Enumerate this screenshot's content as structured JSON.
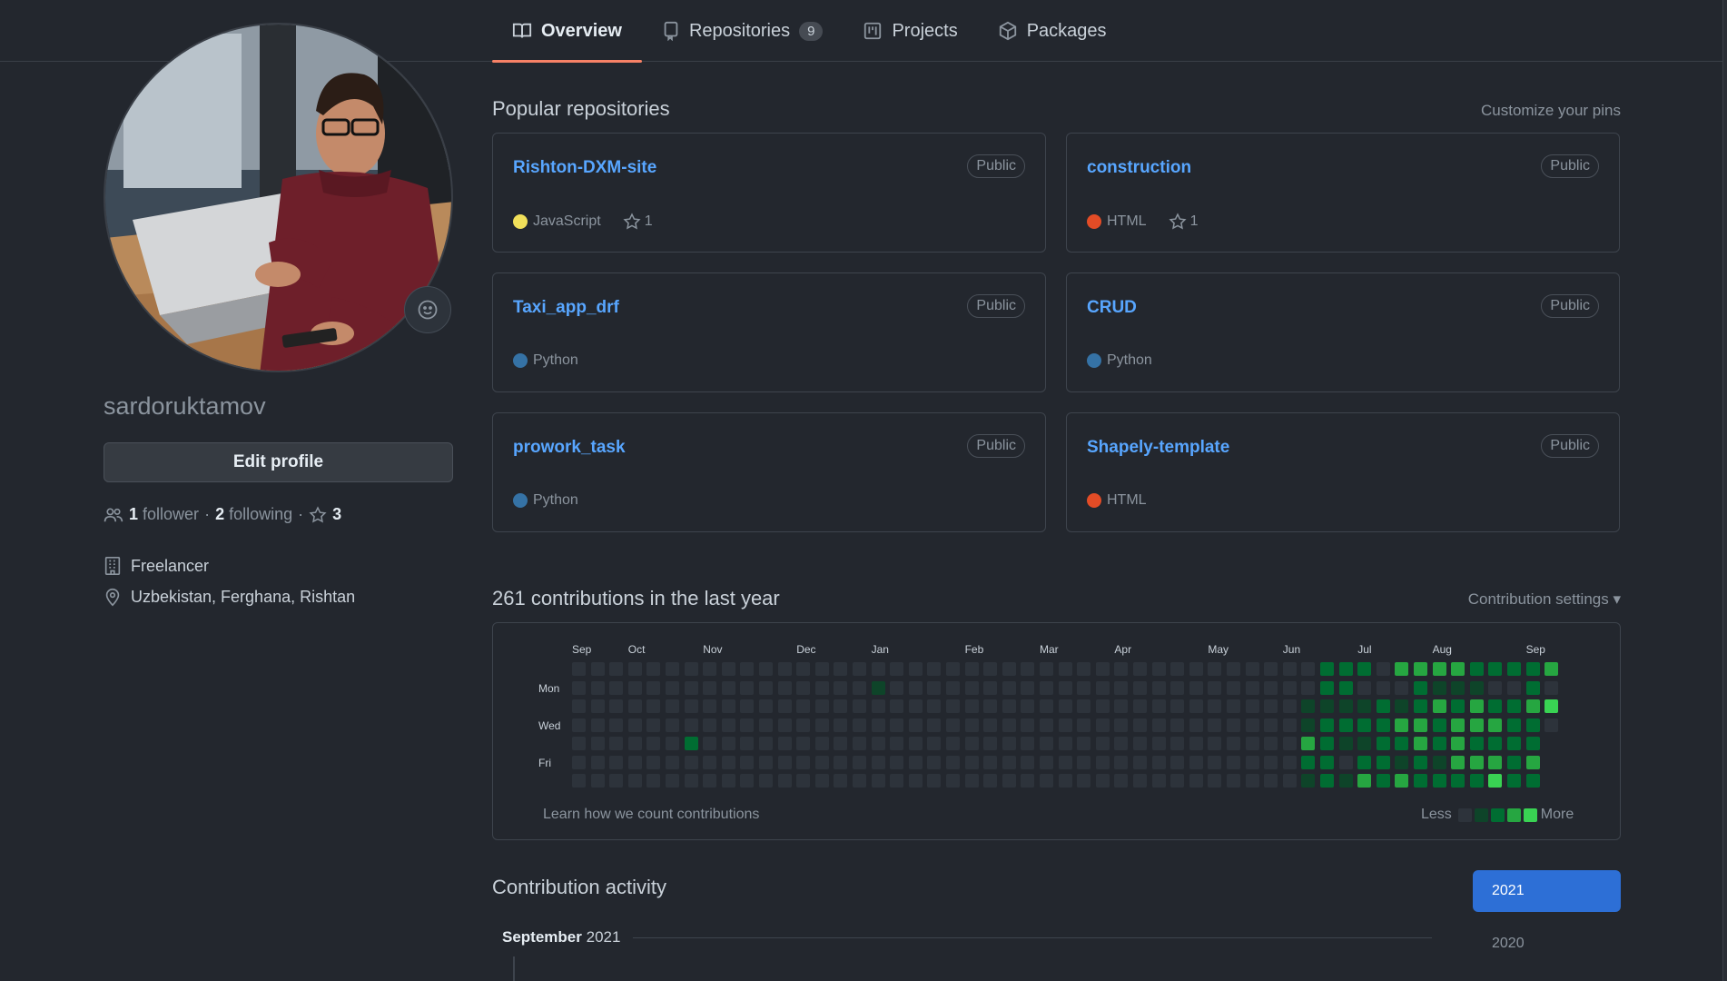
{
  "nav": {
    "tabs": [
      {
        "label": "Overview",
        "icon": "book-icon"
      },
      {
        "label": "Repositories",
        "icon": "repo-icon",
        "count": "9"
      },
      {
        "label": "Projects",
        "icon": "project-icon"
      },
      {
        "label": "Packages",
        "icon": "package-icon"
      }
    ]
  },
  "profile": {
    "username": "sardoruktamov",
    "edit_label": "Edit profile",
    "followers_count": "1",
    "followers_label": "follower",
    "following_count": "2",
    "following_label": "following",
    "stars_count": "3",
    "separator": "·",
    "company": "Freelancer",
    "location": "Uzbekistan, Ferghana, Rishtan"
  },
  "popular": {
    "title": "Popular repositories",
    "customize_label": "Customize your pins",
    "repos": [
      {
        "name": "Rishton-DXM-site",
        "visibility": "Public",
        "language": "JavaScript",
        "lang_color": "#f1e05a",
        "stars": "1"
      },
      {
        "name": "construction",
        "visibility": "Public",
        "language": "HTML",
        "lang_color": "#e34c26",
        "stars": "1"
      },
      {
        "name": "Taxi_app_drf",
        "visibility": "Public",
        "language": "Python",
        "lang_color": "#3572A5"
      },
      {
        "name": "CRUD",
        "visibility": "Public",
        "language": "Python",
        "lang_color": "#3572A5"
      },
      {
        "name": "prowork_task",
        "visibility": "Public",
        "language": "Python",
        "lang_color": "#3572A5"
      },
      {
        "name": "Shapely-template",
        "visibility": "Public",
        "language": "HTML",
        "lang_color": "#e34c26"
      }
    ]
  },
  "contributions": {
    "title": "261 contributions in the last year",
    "settings_label": "Contribution settings ▾",
    "months": [
      "Sep",
      "Oct",
      "Nov",
      "Dec",
      "Jan",
      "Feb",
      "Mar",
      "Apr",
      "May",
      "Jun",
      "Jul",
      "Aug",
      "Sep"
    ],
    "days": [
      "Mon",
      "Wed",
      "Fri"
    ],
    "learn_label": "Learn how we count contributions",
    "legend_less": "Less",
    "legend_more": "More",
    "level_colors": [
      "#2d333b",
      "#0e4429",
      "#006d32",
      "#26a641",
      "#39d353"
    ],
    "weeks": 53,
    "grid": [
      "00000000000000000000000000000000000000000000000000000",
      "00000000000000001000000000000000000000000000000002000",
      "00000000000000000000000000000000000000000000000000000",
      "00000000000000000000000000000000000000000000000000000",
      "00000020000000000000000000000000000000000000000000000",
      "00000000000000000000000000000000000000000000000000000",
      "00000000000000000000000000000000000000000000000000000"
    ],
    "active": [
      "02220333322223",
      "02200021110020",
      "11112123232234",
      "12222332333220",
      "32112232322221",
      "22022121333231",
      "12132322224221"
    ]
  },
  "activity": {
    "title": "Contribution activity",
    "month": "September",
    "year": "2021",
    "years": [
      "2021",
      "2020"
    ]
  }
}
